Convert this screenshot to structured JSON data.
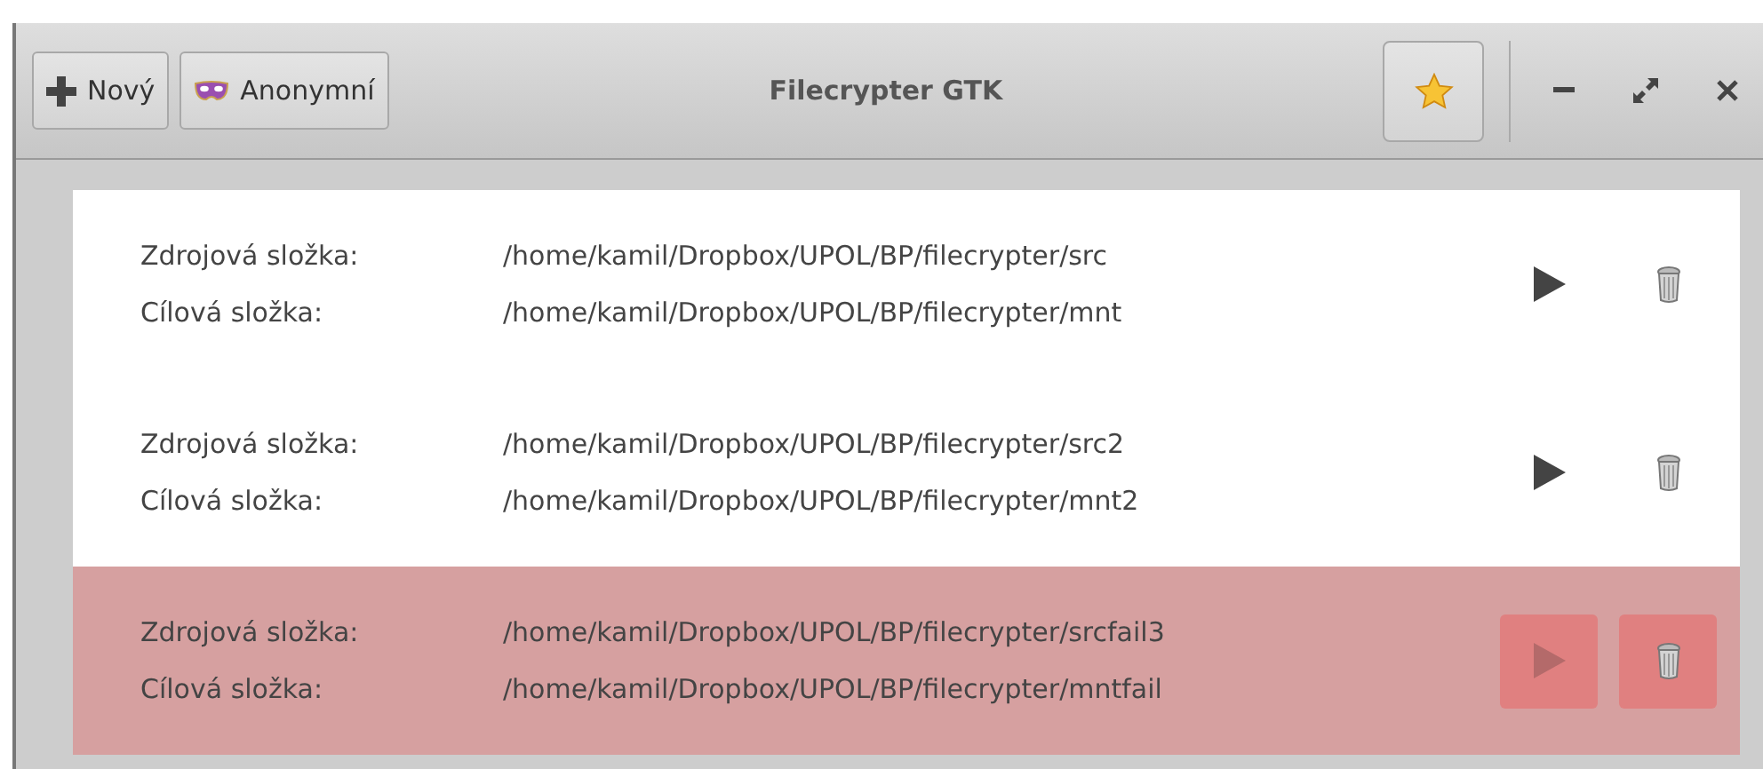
{
  "header": {
    "title": "Filecrypter GTK",
    "buttons": [
      {
        "kind": "new",
        "label": "Nový"
      },
      {
        "kind": "anonymous",
        "label": "Anonymní"
      }
    ]
  },
  "rows": [
    {
      "failed": false,
      "source_label": "Zdrojová složka:",
      "source": "/home/kamil/Dropbox/UPOL/BP/filecrypter/src",
      "target_label": "Cílová složka:",
      "target": "/home/kamil/Dropbox/UPOL/BP/filecrypter/mnt"
    },
    {
      "failed": false,
      "source_label": "Zdrojová složka:",
      "source": "/home/kamil/Dropbox/UPOL/BP/filecrypter/src2",
      "target_label": "Cílová složka:",
      "target": "/home/kamil/Dropbox/UPOL/BP/filecrypter/mnt2"
    },
    {
      "failed": true,
      "source_label": "Zdrojová složka:",
      "source": "/home/kamil/Dropbox/UPOL/BP/filecrypter/srcfail3",
      "target_label": "Cílová složka:",
      "target": "/home/kamil/Dropbox/UPOL/BP/filecrypter/mntfail"
    }
  ]
}
